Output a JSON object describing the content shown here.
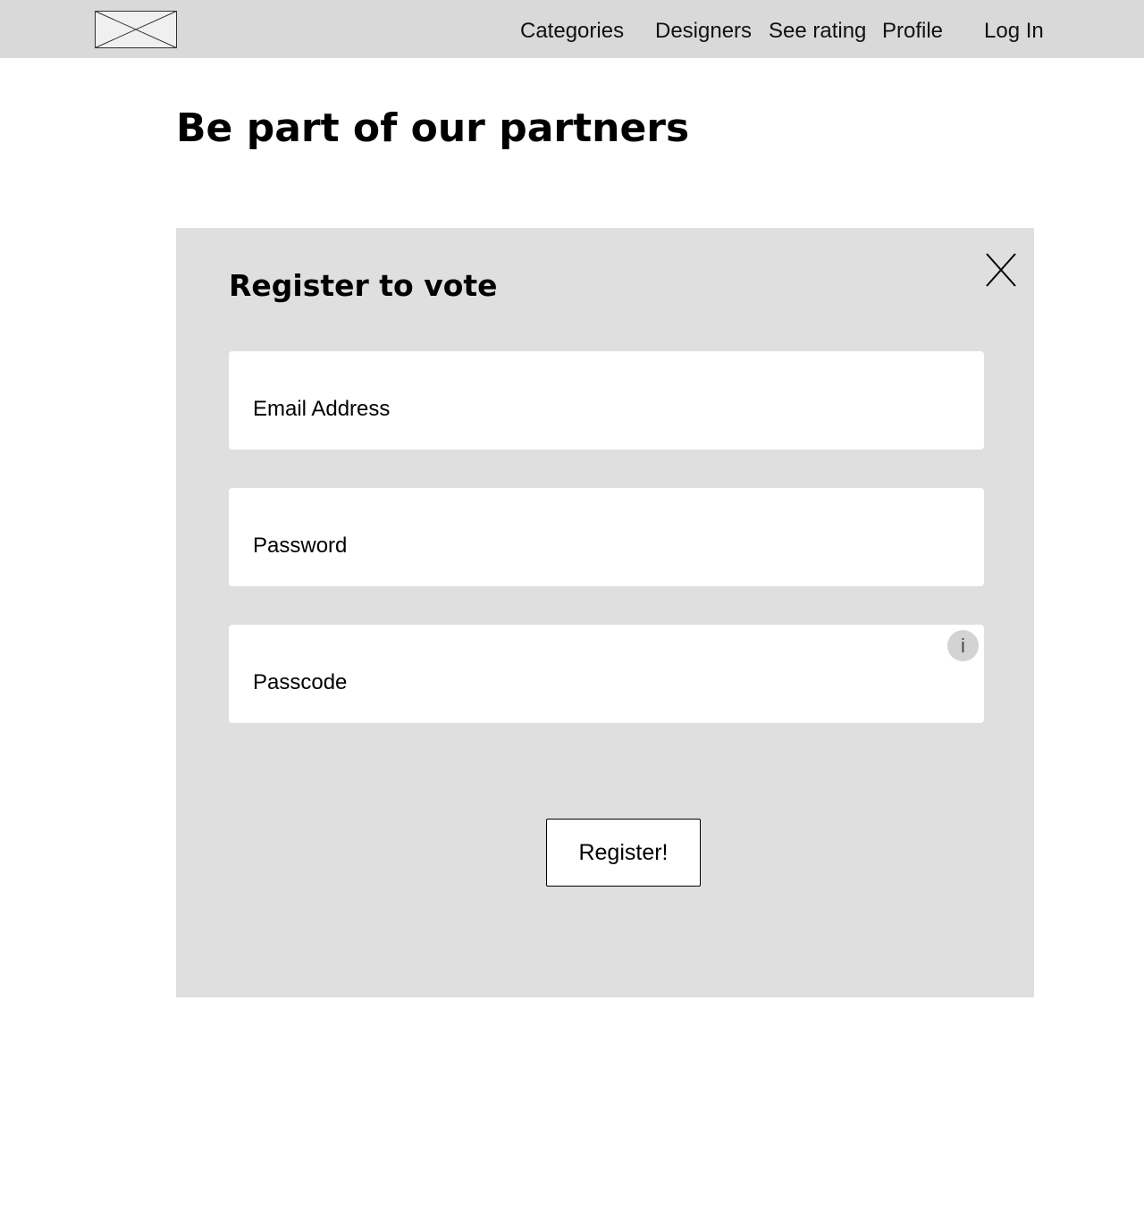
{
  "nav": {
    "items": [
      {
        "label": "Categories"
      },
      {
        "label": "Designers"
      },
      {
        "label": "See rating"
      },
      {
        "label": "Profile"
      },
      {
        "label": "Log In"
      }
    ]
  },
  "page": {
    "title": "Be part of our partners"
  },
  "modal": {
    "title": "Register to vote",
    "close_label": "X",
    "email": {
      "placeholder": "Email Address",
      "value": ""
    },
    "password": {
      "placeholder": "Password",
      "value": ""
    },
    "passcode": {
      "placeholder": "Passcode",
      "value": "",
      "info_label": "i"
    },
    "submit_label": "Register!"
  },
  "colors": {
    "navbar_bg": "#d9d9d9",
    "modal_bg": "#dfdfdf",
    "field_bg": "#ffffff",
    "info_badge_bg": "#d3d3d3"
  },
  "icons": {
    "logo": "image-placeholder-icon",
    "close": "close-icon",
    "info": "info-icon"
  }
}
